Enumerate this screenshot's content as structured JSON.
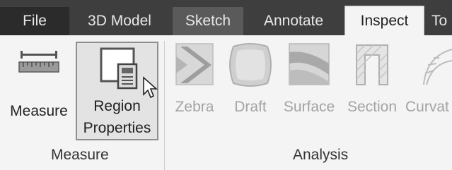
{
  "tabs": [
    {
      "label": "File"
    },
    {
      "label": "3D Model"
    },
    {
      "label": "Sketch"
    },
    {
      "label": "Annotate"
    },
    {
      "label": "Inspect"
    },
    {
      "label": "To"
    }
  ],
  "active_tab": "Inspect",
  "measure_group": {
    "title": "Measure",
    "commands": [
      {
        "label": "Measure",
        "icon": "ruler-icon"
      },
      {
        "label_line1": "Region",
        "label_line2": "Properties",
        "icon": "region-properties-icon"
      }
    ]
  },
  "analysis_group": {
    "title": "Analysis",
    "commands": [
      {
        "label": "Zebra",
        "icon": "zebra-icon"
      },
      {
        "label": "Draft",
        "icon": "draft-icon"
      },
      {
        "label": "Surface",
        "icon": "surface-icon"
      },
      {
        "label": "Section",
        "icon": "section-icon"
      },
      {
        "label": "Curvat",
        "icon": "curvature-icon"
      }
    ]
  },
  "colors": {
    "tabbar": "#3e3e3e",
    "ribbon": "#f4f4f4",
    "disabled_text": "#a3a3a3"
  }
}
